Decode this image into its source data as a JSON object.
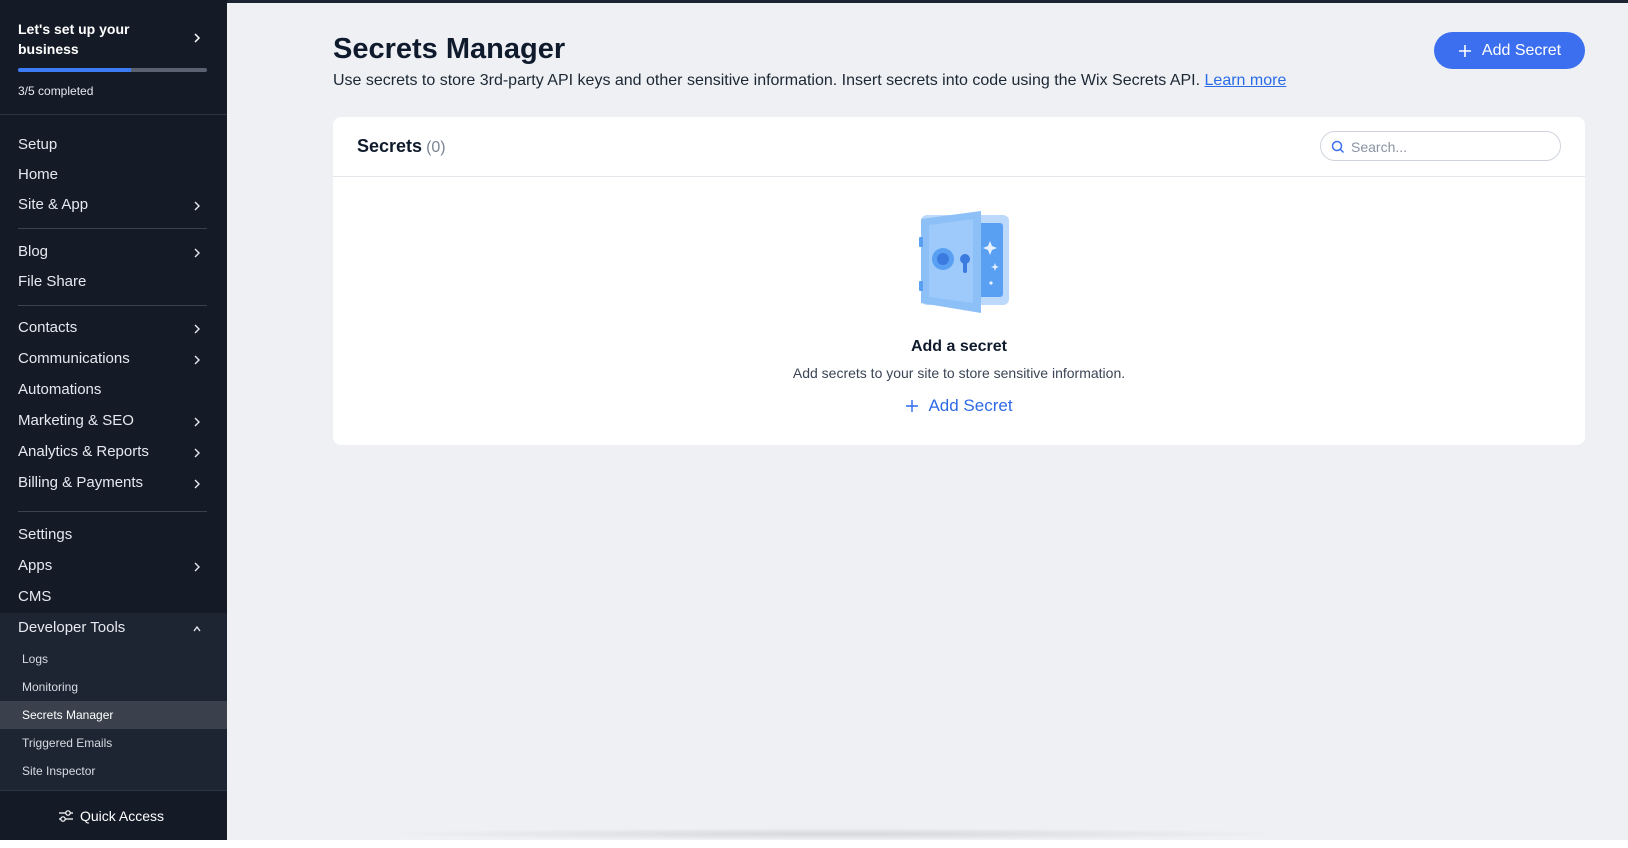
{
  "setup": {
    "title": "Let's set up your business",
    "progress_text": "3/5 completed",
    "progress_fraction": 0.6
  },
  "sidebar": {
    "items": [
      {
        "label": "Setup",
        "has_chevron": false
      },
      {
        "label": "Home",
        "has_chevron": false
      },
      {
        "label": "Site & App",
        "has_chevron": true
      },
      {
        "label": "Blog",
        "has_chevron": true
      },
      {
        "label": "File Share",
        "has_chevron": false
      },
      {
        "label": "Contacts",
        "has_chevron": true
      },
      {
        "label": "Communications",
        "has_chevron": true
      },
      {
        "label": "Automations",
        "has_chevron": false
      },
      {
        "label": "Marketing & SEO",
        "has_chevron": true
      },
      {
        "label": "Analytics & Reports",
        "has_chevron": true
      },
      {
        "label": "Billing & Payments",
        "has_chevron": true
      },
      {
        "label": "Settings",
        "has_chevron": false
      },
      {
        "label": "Apps",
        "has_chevron": true
      },
      {
        "label": "CMS",
        "has_chevron": false
      },
      {
        "label": "Developer Tools",
        "has_chevron": true,
        "expanded": true
      }
    ],
    "sub_items": [
      {
        "label": "Logs"
      },
      {
        "label": "Monitoring"
      },
      {
        "label": "Secrets Manager",
        "active": true
      },
      {
        "label": "Triggered Emails"
      },
      {
        "label": "Site Inspector"
      }
    ],
    "quick_access": "Quick Access"
  },
  "page": {
    "title": "Secrets Manager",
    "description": "Use secrets to store 3rd-party API keys and other sensitive information. Insert secrets into code using the Wix Secrets API.",
    "learn_more": "Learn more",
    "add_button": "Add Secret"
  },
  "secrets": {
    "title": "Secrets",
    "count": "(0)",
    "search_placeholder": "Search...",
    "empty_title": "Add a secret",
    "empty_desc": "Add secrets to your site to store sensitive information.",
    "empty_button": "Add Secret"
  },
  "colors": {
    "sidebar_bg": "#141b27",
    "accent": "#3b6ff0",
    "page_bg": "#eef0f4"
  }
}
